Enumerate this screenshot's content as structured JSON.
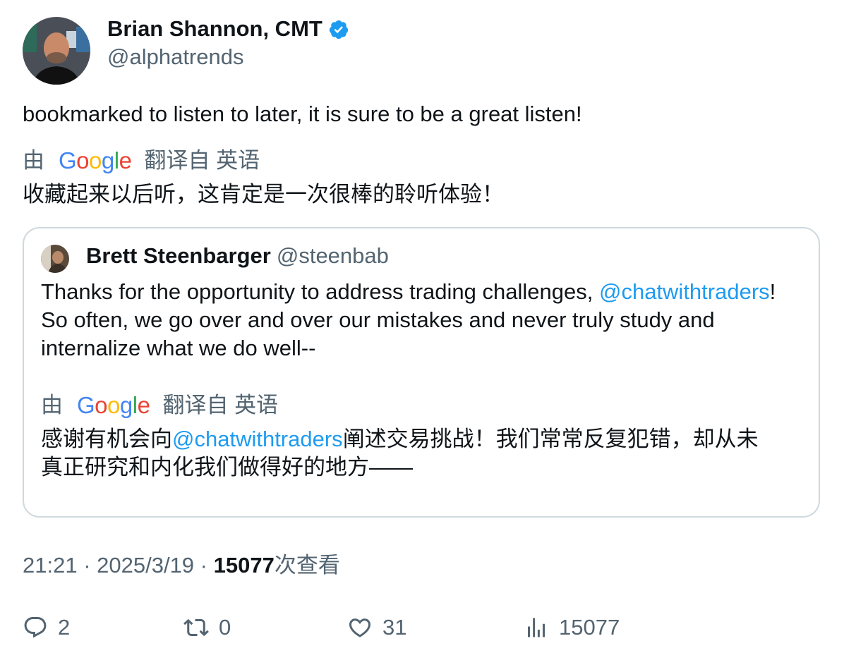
{
  "tweet": {
    "author_name": "Brian Shannon, CMT",
    "author_handle": "@alphatrends",
    "text": "bookmarked to listen to later, it is sure to be a great listen!",
    "translation": {
      "prefix": "由",
      "provider": "Google",
      "suffix": "翻译自 英语",
      "text": "收藏起来以后听，这肯定是一次很棒的聆听体验！"
    }
  },
  "quote": {
    "author_name": "Brett Steenbarger",
    "author_handle": "@steenbab",
    "text_line1_a": "Thanks for the opportunity to address trading challenges, ",
    "text_line1_mention": "@chatwithtraders",
    "text_line1_b": "!",
    "text_line2": "So often, we go over and over our mistakes and never truly study and",
    "text_line3": "internalize what we do well--",
    "translation": {
      "prefix": "由",
      "provider": "Google",
      "suffix": "翻译自 英语",
      "line1_a": "感谢有机会向",
      "line1_mention": "@chatwithtraders",
      "line1_b": "阐述交易挑战！我们常常反复犯错，却从未",
      "line2": "真正研究和内化我们做得好的地方——"
    }
  },
  "meta": {
    "time": "21:21",
    "sep1": " · ",
    "date": "2025/3/19",
    "sep2": " · ",
    "views_count": "15077",
    "views_label": "次查看"
  },
  "actions": {
    "replies": "2",
    "retweets": "0",
    "likes": "31",
    "views": "15077"
  },
  "icons": {
    "verified": "verified-badge-icon",
    "reply": "reply-icon",
    "retweet": "retweet-icon",
    "like": "heart-icon",
    "views": "analytics-icon"
  },
  "colors": {
    "link": "#1d9bf0",
    "secondary_text": "#536471",
    "primary_text": "#0f1419",
    "border": "#cfd9de"
  }
}
